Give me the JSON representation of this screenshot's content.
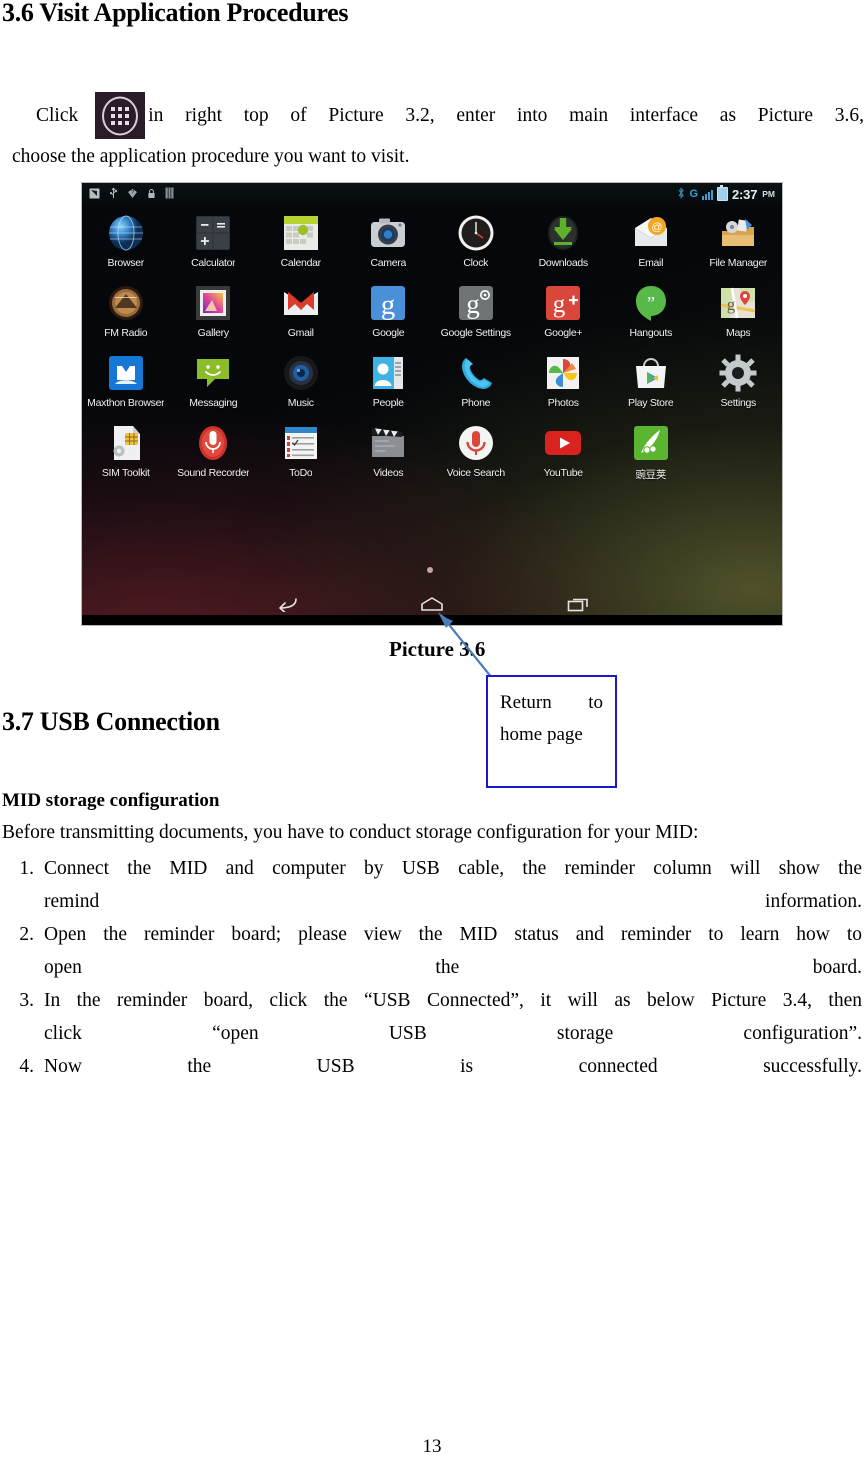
{
  "document": {
    "section_36": {
      "heading": "3.6 Visit Application Procedures",
      "paragraph_prefix": "Click",
      "icon_name": "app-drawer-icon",
      "paragraph_line1_words": [
        "in",
        "right",
        "top",
        "of",
        "Picture",
        "3.2,",
        "enter",
        "into",
        "main",
        "interface",
        "as",
        "Picture",
        "3.6,"
      ],
      "paragraph_line2": "choose the application procedure you want to visit."
    },
    "figure": {
      "caption": "Picture 3.6",
      "callout": {
        "line1_left": "Return",
        "line1_right": "to",
        "line2": "home page",
        "border_color": "#1818cd"
      },
      "arrow_color": "#4a7ebb"
    },
    "section_37": {
      "heading": "3.7 USB Connection",
      "lead_bold": "MID storage configuration",
      "lead_paragraph": "Before transmitting documents, you have to conduct storage configuration for your MID:",
      "steps": [
        {
          "num": "1.",
          "lines": [
            "Connect the MID and computer by USB cable, the reminder column will show the",
            "remind information."
          ]
        },
        {
          "num": "2.",
          "lines": [
            "Open the reminder board; please view the MID status and reminder to learn how to",
            "open the board."
          ]
        },
        {
          "num": "3.",
          "lines": [
            "In the reminder board, click the “USB Connected”, it will as below Picture 3.4, then",
            "click “open USB storage configuration”."
          ]
        },
        {
          "num": "4.",
          "lines": [
            "Now the USB is connected successfully."
          ]
        }
      ]
    },
    "page_number": "13"
  },
  "screenshot": {
    "statusbar": {
      "left_icons": [
        "screenshot-icon",
        "usb-icon",
        "debug-icon",
        "lock-icon",
        "sim-card-icon"
      ],
      "bluetooth": "bluetooth-icon",
      "network_type": "G",
      "signal": "signal-bars-icon",
      "battery": "battery-icon",
      "time": "2:37",
      "meridiem": "PM"
    },
    "apps": [
      {
        "label": "Browser",
        "icon": "browser-globe-icon"
      },
      {
        "label": "Calculator",
        "icon": "calculator-icon"
      },
      {
        "label": "Calendar",
        "icon": "calendar-icon"
      },
      {
        "label": "Camera",
        "icon": "camera-icon"
      },
      {
        "label": "Clock",
        "icon": "clock-icon"
      },
      {
        "label": "Downloads",
        "icon": "downloads-arrow-icon"
      },
      {
        "label": "Email",
        "icon": "email-envelope-icon"
      },
      {
        "label": "File Manager",
        "icon": "file-manager-icon"
      },
      {
        "label": "FM Radio",
        "icon": "fm-radio-icon"
      },
      {
        "label": "Gallery",
        "icon": "gallery-icon"
      },
      {
        "label": "Gmail",
        "icon": "gmail-icon"
      },
      {
        "label": "Google",
        "icon": "google-icon"
      },
      {
        "label": "Google Settings",
        "icon": "google-settings-icon"
      },
      {
        "label": "Google+",
        "icon": "google-plus-icon"
      },
      {
        "label": "Hangouts",
        "icon": "hangouts-icon"
      },
      {
        "label": "Maps",
        "icon": "maps-icon"
      },
      {
        "label": "Maxthon Browser",
        "icon": "maxthon-icon"
      },
      {
        "label": "Messaging",
        "icon": "messaging-icon"
      },
      {
        "label": "Music",
        "icon": "music-speaker-icon"
      },
      {
        "label": "People",
        "icon": "people-contacts-icon"
      },
      {
        "label": "Phone",
        "icon": "phone-handset-icon"
      },
      {
        "label": "Photos",
        "icon": "photos-pinwheel-icon"
      },
      {
        "label": "Play Store",
        "icon": "play-store-icon"
      },
      {
        "label": "Settings",
        "icon": "settings-gear-icon"
      },
      {
        "label": "SIM Toolkit",
        "icon": "sim-toolkit-icon"
      },
      {
        "label": "Sound Recorder",
        "icon": "sound-recorder-mic-icon"
      },
      {
        "label": "ToDo",
        "icon": "todo-list-icon"
      },
      {
        "label": "Videos",
        "icon": "videos-clapper-icon"
      },
      {
        "label": "Voice Search",
        "icon": "voice-search-mic-icon"
      },
      {
        "label": "YouTube",
        "icon": "youtube-icon"
      },
      {
        "label": "豌豆荚",
        "icon": "wandoujia-icon"
      }
    ],
    "navbar": {
      "back": "back-icon",
      "home": "home-icon",
      "recents": "recents-icon"
    }
  }
}
